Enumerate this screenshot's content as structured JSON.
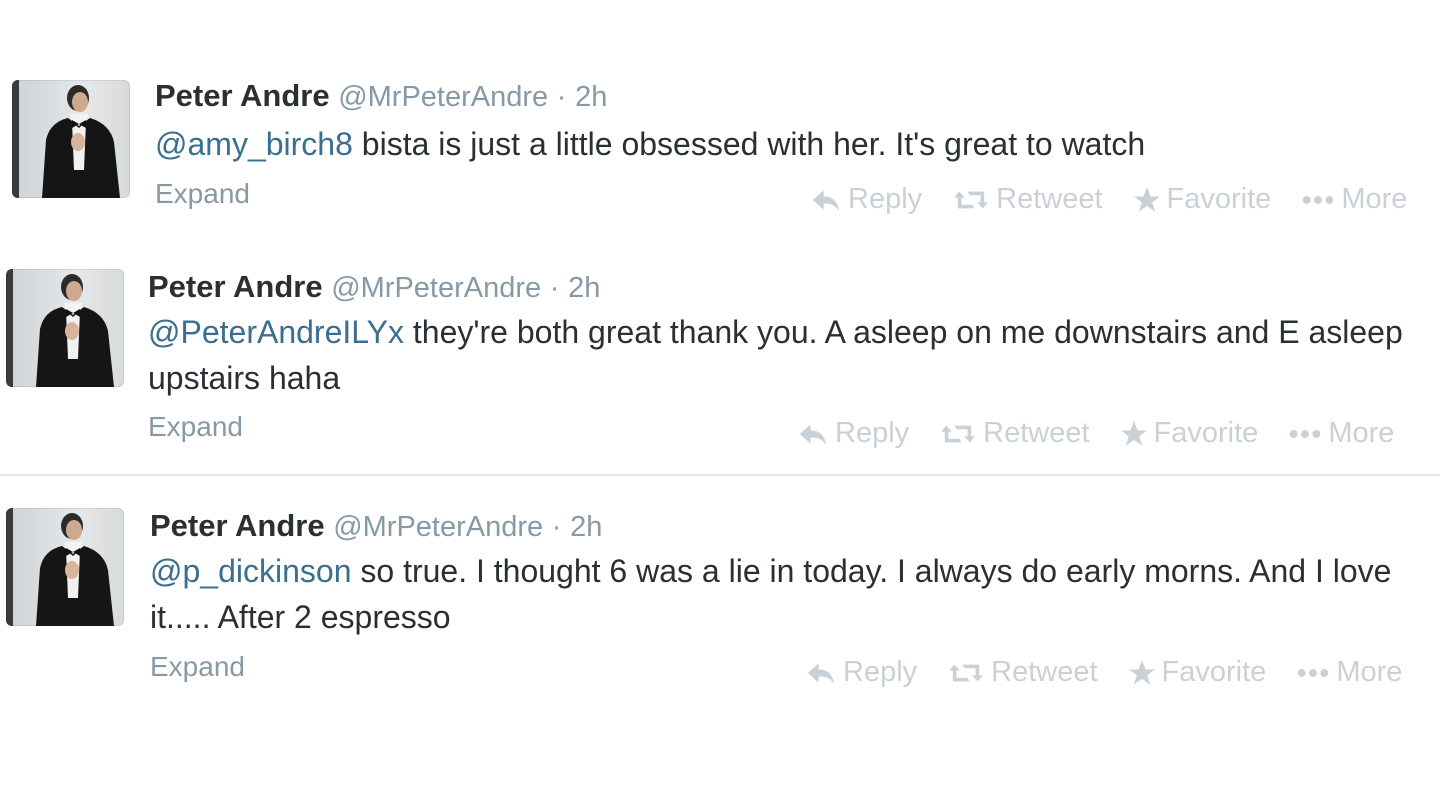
{
  "tweets": [
    {
      "name": "Peter Andre",
      "handle": "@MrPeterAndre",
      "dot": "·",
      "time": "2h",
      "mention": "@amy_birch8",
      "text": " bista is just a little obsessed with her. It's great to watch",
      "expand": "Expand",
      "actions": {
        "reply": "Reply",
        "retweet": "Retweet",
        "favorite": "Favorite",
        "more": "More"
      }
    },
    {
      "name": "Peter Andre",
      "handle": "@MrPeterAndre",
      "dot": "·",
      "time": "2h",
      "mention": "@PeterAndreILYx",
      "text": " they're both great thank you. A asleep on me downstairs and E asleep upstairs haha",
      "expand": "Expand",
      "actions": {
        "reply": "Reply",
        "retweet": "Retweet",
        "favorite": "Favorite",
        "more": "More"
      }
    },
    {
      "name": "Peter Andre",
      "handle": "@MrPeterAndre",
      "dot": "·",
      "time": "2h",
      "mention": "@p_dickinson",
      "text": " so true. I thought 6 was a lie in today. I always do early morns. And I love it..... After 2 espresso",
      "expand": "Expand",
      "actions": {
        "reply": "Reply",
        "retweet": "Retweet",
        "favorite": "Favorite",
        "more": "More"
      }
    }
  ]
}
